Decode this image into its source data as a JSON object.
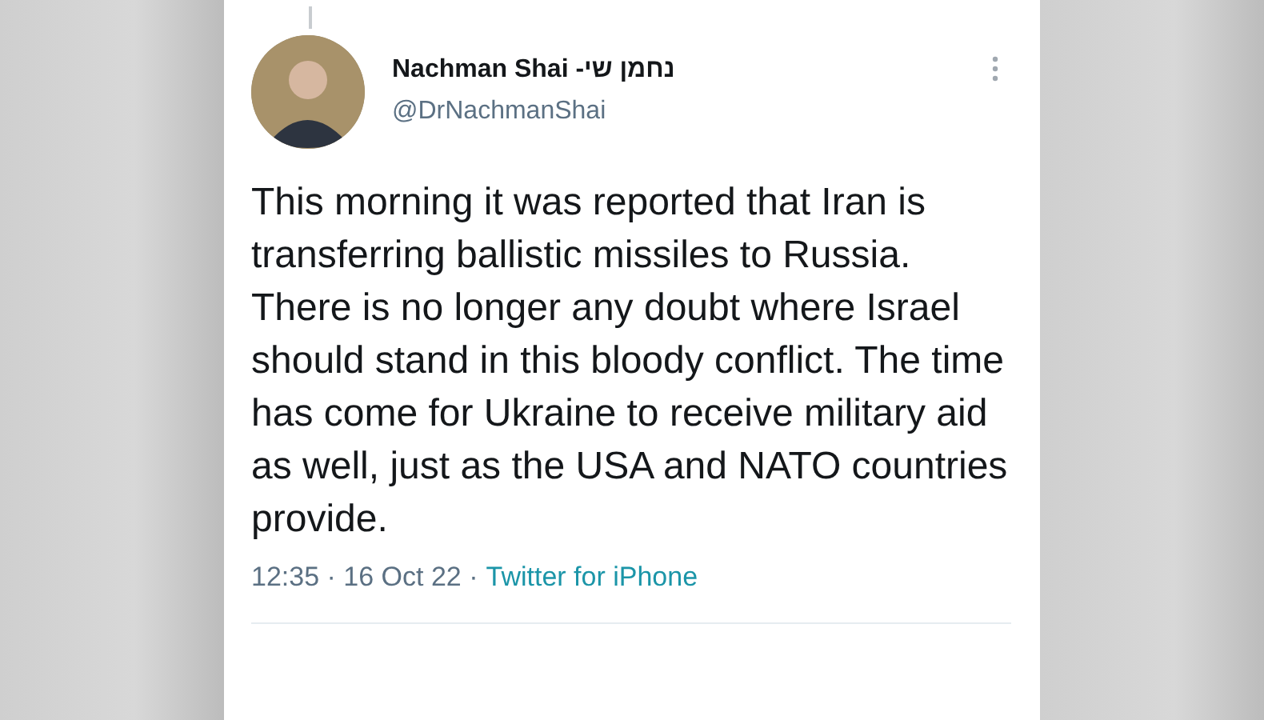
{
  "tweet": {
    "author_name": "Nachman Shai -נחמן שי",
    "handle": "@DrNachmanShai",
    "text": "This morning it was reported that Iran is transferring ballistic missiles to Russia. There is no longer any doubt where Israel should stand in this bloody conflict. The time has come for Ukraine to receive military aid as well, just as the USA and NATO countries provide.",
    "meta": "12:35 · 16 Oct 22 ·",
    "source": "Twitter for iPhone"
  }
}
